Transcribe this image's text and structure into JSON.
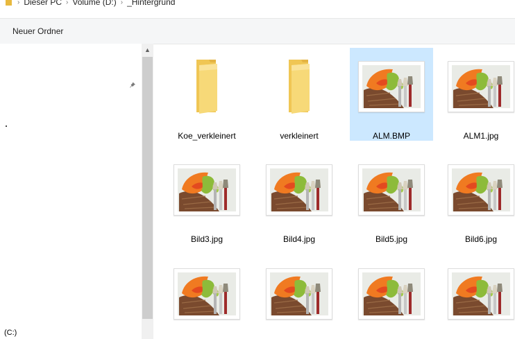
{
  "breadcrumb": {
    "items": [
      "Dieser PC",
      "Volume (D:)",
      "_Hintergrund"
    ]
  },
  "commandbar": {
    "new_folder_label": "Neuer Ordner"
  },
  "navpane": {
    "drive_label": "(C:)"
  },
  "items": [
    {
      "label": "Koe_verkleinert",
      "kind": "folder",
      "selected": false
    },
    {
      "label": "verkleinert",
      "kind": "folder",
      "selected": false
    },
    {
      "label": "ALM.BMP",
      "kind": "image",
      "selected": true
    },
    {
      "label": "ALM1.jpg",
      "kind": "image",
      "selected": false
    },
    {
      "label": "Bild3.jpg",
      "kind": "image",
      "selected": false
    },
    {
      "label": "Bild4.jpg",
      "kind": "image",
      "selected": false
    },
    {
      "label": "Bild5.jpg",
      "kind": "image",
      "selected": false
    },
    {
      "label": "Bild6.jpg",
      "kind": "image",
      "selected": false
    },
    {
      "label": "",
      "kind": "image",
      "selected": false
    },
    {
      "label": "",
      "kind": "image",
      "selected": false
    },
    {
      "label": "",
      "kind": "image",
      "selected": false
    },
    {
      "label": "",
      "kind": "image",
      "selected": false
    }
  ],
  "colors": {
    "selection": "#cce8ff",
    "folder": "#f3cf63",
    "commandbar_bg": "#f5f6f7"
  }
}
